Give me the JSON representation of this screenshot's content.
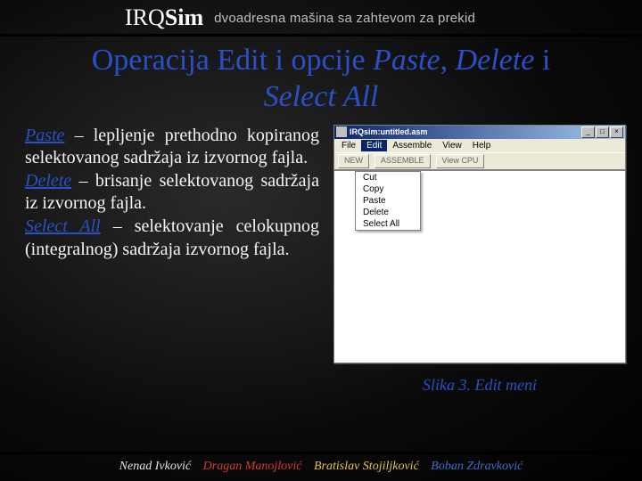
{
  "header": {
    "logo_prefix": "IRQ",
    "logo_suffix": "Sim",
    "subtitle": "dvoadresna mašina sa zahtevom za prekid"
  },
  "title": {
    "p1": "Operacija  Edit i opcije ",
    "it1": "Paste",
    "comma": ", ",
    "it2": "Delete",
    "i_text": " i ",
    "it3": "Select All"
  },
  "body": {
    "term1": "Paste",
    "t1": " – lepljenje prethodno kopiranog selektovanog sadržaja iz izvornog fajla.",
    "term2": "Delete",
    "t2": " – brisanje selektovanog sadržaja iz izvornog fajla.",
    "term3": "Select All",
    "t3": " – selektovanje celokupnog (integralnog) sadržaja izvornog fajla."
  },
  "window": {
    "title": "IRQsim:untitled.asm",
    "menus": [
      "File",
      "Edit",
      "Assemble",
      "View",
      "Help"
    ],
    "active_menu_index": 1,
    "buttons": [
      "NEW",
      "ASSEMBLE",
      "View CPU"
    ],
    "dropdown": [
      "Cut",
      "Copy",
      "Paste",
      "Delete",
      "Select All"
    ],
    "win_min": "_",
    "win_max": "□",
    "win_close": "×"
  },
  "caption": "Slika 3. Edit meni",
  "authors": {
    "a1": "Nenad Ivković",
    "a2": "Dragan Manojlović",
    "a3": "Bratislav Stojiljković",
    "a4": "Boban Zdravković"
  }
}
